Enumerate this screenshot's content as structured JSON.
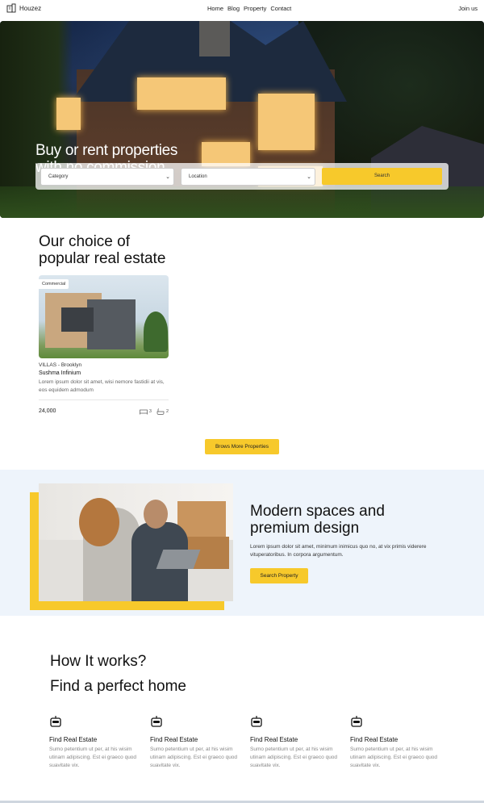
{
  "nav": {
    "brand": "Houzez",
    "links": [
      "Home",
      "Blog",
      "Property",
      "Contact"
    ],
    "join": "Join us"
  },
  "hero": {
    "title_line1": "Buy or rent properties",
    "title_line2": "with no commission",
    "category": "Category",
    "location": "Location",
    "search_label": "Search"
  },
  "popular": {
    "title_line1": "Our choice of",
    "title_line2": "popular real estate",
    "card": {
      "badge": "Commercial",
      "location": "VILLAS - Brooklyn",
      "name": "Sushma Infinium",
      "description": "Lorem ipsum dolor sit amet, wisi nemore fastidii at vis, eos equidem admodum",
      "price": "24,000",
      "beds": "3",
      "baths": "2"
    },
    "browse_label": "Brows More Properties"
  },
  "modern": {
    "title_line1": "Modern spaces and",
    "title_line2": "premium design",
    "text": "Lorem ipsum dolor sit amet, minimum inimicus quo no, at vix primis viderere vituperatoribus. In corpora argumentum.",
    "button_label": "Search Property"
  },
  "how": {
    "title_line1": "How It works?",
    "title_line2": "Find a perfect home",
    "steps": [
      {
        "title": "Find Real Estate",
        "desc": "Sumo petentium ut per, at his wisim utinam adipiscing. Est ei graeco quod suavitate vix."
      },
      {
        "title": "Find Real Estate",
        "desc": "Sumo petentium ut per, at his wisim utinam adipiscing. Est ei graeco quod suavitate vix."
      },
      {
        "title": "Find Real Estate",
        "desc": "Sumo petentium ut per, at his wisim utinam adipiscing. Est ei graeco quod suavitate vix."
      },
      {
        "title": "Find Real Estate",
        "desc": "Sumo petentium ut per, at his wisim utinam adipiscing. Est ei graeco quod suavitate vix."
      }
    ]
  },
  "colors": {
    "accent": "#f7c92b",
    "section_bg": "#eef4fb"
  },
  "icons": {
    "logo": "building-icon",
    "bed": "bed-icon",
    "bath": "bath-icon",
    "step": "robot-icon"
  }
}
